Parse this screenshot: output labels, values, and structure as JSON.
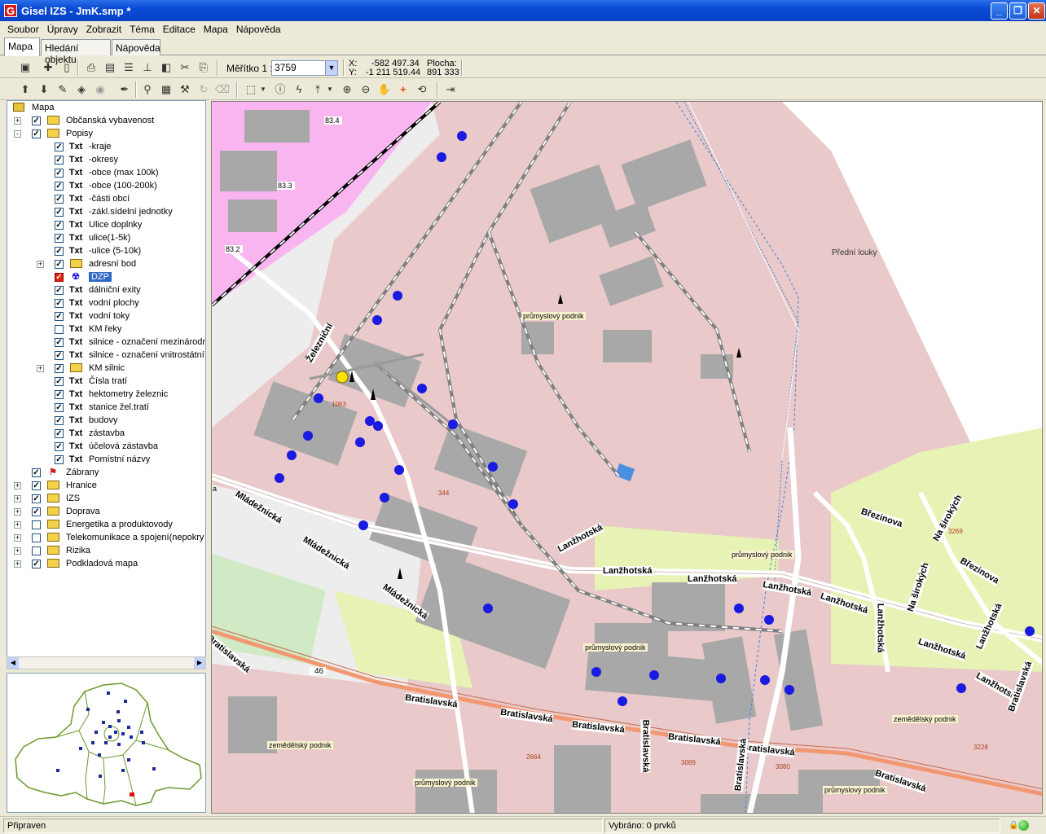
{
  "window": {
    "title": "Gisel IZS - JmK.smp *",
    "app_icon": "G"
  },
  "menu": [
    "Soubor",
    "Úpravy",
    "Zobrazit",
    "Téma",
    "Editace",
    "Mapa",
    "Nápověda"
  ],
  "tabs": [
    "Mapa",
    "Hledání objektu",
    "Nápověda"
  ],
  "scale": {
    "label": "Měřítko 1 :",
    "value": "3759"
  },
  "coords": {
    "x_label": "X:",
    "x_value": "-582 497.34",
    "y_label": "Y:",
    "y_value": "-1 211 519.44",
    "area_label": "Plocha:",
    "area_value": "891 333"
  },
  "layers": [
    {
      "label": "Mapa",
      "level": 0,
      "icon": "map-icon",
      "check": null,
      "exp": null
    },
    {
      "label": "Občanská vybavenost",
      "level": 1,
      "icon": "layer-folder-icon",
      "check": true,
      "exp": "+"
    },
    {
      "label": "Popisy",
      "level": 1,
      "icon": "layer-folder-icon",
      "check": true,
      "exp": "-"
    },
    {
      "label": "-kraje",
      "level": 2,
      "icon": "Txt",
      "check": true
    },
    {
      "label": "-okresy",
      "level": 2,
      "icon": "Txt",
      "check": true
    },
    {
      "label": "-obce (max 100k)",
      "level": 2,
      "icon": "Txt",
      "check": true
    },
    {
      "label": "-obce (100-200k)",
      "level": 2,
      "icon": "Txt",
      "check": true
    },
    {
      "label": "-části obcí",
      "level": 2,
      "icon": "Txt",
      "check": true
    },
    {
      "label": "-zákl.sídelní jednotky",
      "level": 2,
      "icon": "Txt",
      "check": true
    },
    {
      "label": "Ulice doplnky",
      "level": 2,
      "icon": "Txt",
      "check": true
    },
    {
      "label": "ulice(1-5k)",
      "level": 2,
      "icon": "Txt",
      "check": true
    },
    {
      "label": "-ulice (5-10k)",
      "level": 2,
      "icon": "Txt",
      "check": true
    },
    {
      "label": "adresní bod",
      "level": 2,
      "icon": "layer-folder-icon",
      "check": true,
      "exp": "+"
    },
    {
      "label": "DZP",
      "level": 2,
      "icon": "radiation-icon",
      "check": "red",
      "selected": true
    },
    {
      "label": "dálniční exity",
      "level": 2,
      "icon": "Txt",
      "check": true
    },
    {
      "label": "vodní plochy",
      "level": 2,
      "icon": "Txt",
      "check": true
    },
    {
      "label": "vodní toky",
      "level": 2,
      "icon": "Txt",
      "check": true
    },
    {
      "label": "KM řeky",
      "level": 2,
      "icon": "Txt",
      "check": false
    },
    {
      "label": "silnice - označení mezinárodn",
      "level": 2,
      "icon": "Txt",
      "check": true
    },
    {
      "label": "silnice - označení vnitrostátní",
      "level": 2,
      "icon": "Txt",
      "check": true
    },
    {
      "label": "KM silnic",
      "level": 2,
      "icon": "layer-folder-icon",
      "check": true,
      "exp": "+"
    },
    {
      "label": "Čísla tratí",
      "level": 2,
      "icon": "Txt",
      "check": true
    },
    {
      "label": "hektometry železnic",
      "level": 2,
      "icon": "Txt",
      "check": true
    },
    {
      "label": "stanice žel.tratí",
      "level": 2,
      "icon": "Txt",
      "check": true
    },
    {
      "label": "budovy",
      "level": 2,
      "icon": "Txt",
      "check": true
    },
    {
      "label": "zástavba",
      "level": 2,
      "icon": "Txt",
      "check": true
    },
    {
      "label": "účelová zástavba",
      "level": 2,
      "icon": "Txt",
      "check": true
    },
    {
      "label": "Pomístní názvy",
      "level": 2,
      "icon": "Txt",
      "check": true
    },
    {
      "label": "Zábrany",
      "level": 1,
      "icon": "barrier-icon",
      "check": true
    },
    {
      "label": "Hranice",
      "level": 1,
      "icon": "layer-folder-icon",
      "check": true,
      "exp": "+"
    },
    {
      "label": "IZS",
      "level": 1,
      "icon": "layer-folder-icon",
      "check": true,
      "exp": "+"
    },
    {
      "label": "Doprava",
      "level": 1,
      "icon": "layer-folder-icon",
      "check": true,
      "exp": "+"
    },
    {
      "label": "Energetika a produktovody",
      "level": 1,
      "icon": "layer-folder-icon",
      "check": false,
      "exp": "+"
    },
    {
      "label": "Telekomunikace a spojení(nepokry",
      "level": 1,
      "icon": "layer-folder-icon",
      "check": false,
      "exp": "+"
    },
    {
      "label": "Rizika",
      "level": 1,
      "icon": "layer-folder-icon",
      "check": false,
      "exp": "+"
    },
    {
      "label": "Podkladová mapa",
      "level": 1,
      "icon": "layer-folder-icon",
      "check": true,
      "exp": "+"
    }
  ],
  "map_labels": {
    "predni_louky": "Přední louky",
    "prumyslovy1": "průmyslový podnik",
    "prumyslovy2": "průmyslový podnik",
    "prumyslovy3": "průmyslový podnik",
    "prumyslovy4": "průmyslový podnik",
    "prumyslovy5": "průmyslový podnik",
    "zemedelsky1": "zemědělský podnik",
    "zemedelsky2": "zemědělský podnik",
    "zelezni": "Železniční",
    "mladeznicka1": "Mládežnická",
    "mladeznicka2": "Mládežnická",
    "mladeznicka3": "Mládežnická",
    "lanzhotska1": "Lanžhotská",
    "lanzhotska2": "Lanžhotská",
    "lanzhotska3": "Lanžhotská",
    "lanzhotska4": "Lanžhotská",
    "lanzhotska5": "Lanžhotská",
    "lanzhotska6": "Lanžhotská",
    "lanzhotska7": "Lanžhotská",
    "lanzhotska8": "Lanžhotská",
    "lanzhotska9": "Lanžhotská",
    "brezinova1": "Březinova",
    "brezinova2": "Březinova",
    "na_sirokych1": "Na širokých",
    "na_sirokych2": "Na širokých",
    "bratislavska1": "Bratislavská",
    "bratislavska2": "Bratislavská",
    "bratislavska3": "Bratislavská",
    "bratislavska4": "Bratislavská",
    "bratislavska5": "Bratislavská",
    "bratislavska6": "Bratislavská",
    "bratislavska7": "Bratislavská",
    "bratislavska8": "Bratislavská",
    "bratislavska9": "Bratislavská",
    "bratislavska10": "Bratislavská",
    "km834": "83.4",
    "km833": "83.3",
    "km832": "83.2",
    "n1063": "1063",
    "n344": "344",
    "n46": "46",
    "n2664": "2664",
    "n3089": "3089",
    "n3080": "3080",
    "n3228": "3228",
    "n3269": "3269",
    "edge_a": "a"
  },
  "status": {
    "ready": "Připraven",
    "selected": "Vybráno: 0  prvků"
  },
  "colors": {
    "industrial": "#E9C9C9",
    "residential": "#E6F3B4",
    "rail_area": "#F9B5F0",
    "road": "#FFFFFF",
    "building": "#A8A8A8",
    "main_road": "#F29870",
    "hazard": "#1A1AE0"
  }
}
